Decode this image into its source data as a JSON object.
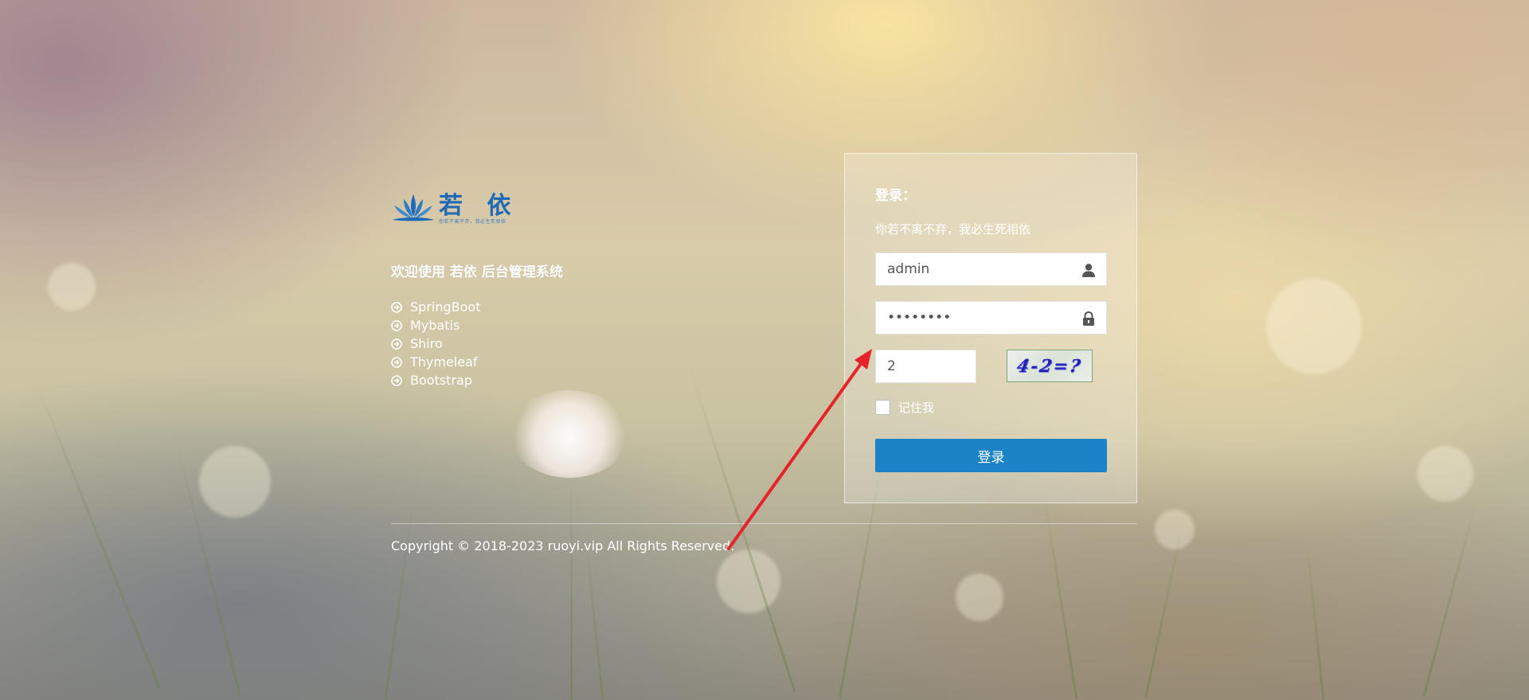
{
  "brand": {
    "name": "若 依",
    "slogan": "你若不离不弃，我必生死相依"
  },
  "welcome": "欢迎使用 若依 后台管理系统",
  "tech_stack": [
    "SpringBoot",
    "Mybatis",
    "Shiro",
    "Thymeleaf",
    "Bootstrap"
  ],
  "login": {
    "heading": "登录：",
    "subtitle": "你若不离不弃，我必生死相依",
    "username_value": "admin",
    "password_value": "admin123",
    "captcha_value": "2",
    "captcha_image_text": "4-2=?",
    "remember_label": "记住我",
    "remember_checked": false,
    "submit_label": "登录"
  },
  "footer": {
    "copyright": "Copyright © 2018-2023 ruoyi.vip All Rights Reserved."
  },
  "colors": {
    "primary_button": "#1c84c6",
    "logo_blue": "#1e6ab6",
    "annotation_arrow": "#e8222a"
  },
  "icons": {
    "username": "user-icon",
    "password": "lock-icon",
    "list_bullet": "arrow-circle-right-icon"
  }
}
